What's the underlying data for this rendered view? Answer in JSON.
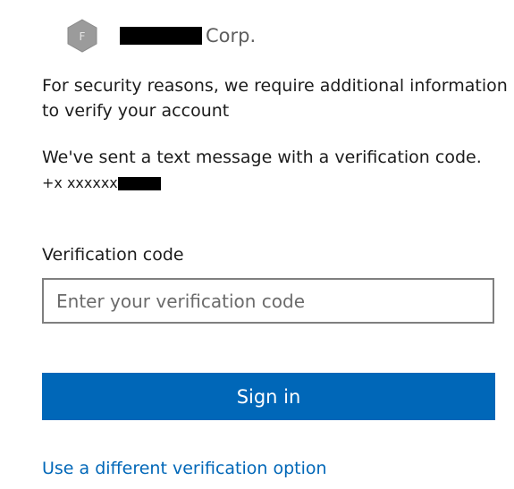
{
  "brand": {
    "logo_letter": "F",
    "name_suffix": "Corp."
  },
  "message": {
    "security": "For security reasons, we require additional information to verify your account",
    "sent": "We've sent a text message with a verification code.",
    "phone_prefix": "+x xxxxxx"
  },
  "form": {
    "label": "Verification code",
    "placeholder": "Enter your verification code",
    "value": "",
    "submit_label": "Sign in"
  },
  "links": {
    "alternate": "Use a different verification option"
  },
  "colors": {
    "accent": "#0067b8",
    "text": "#1b1b1b",
    "logo": "#9b9b9b"
  }
}
